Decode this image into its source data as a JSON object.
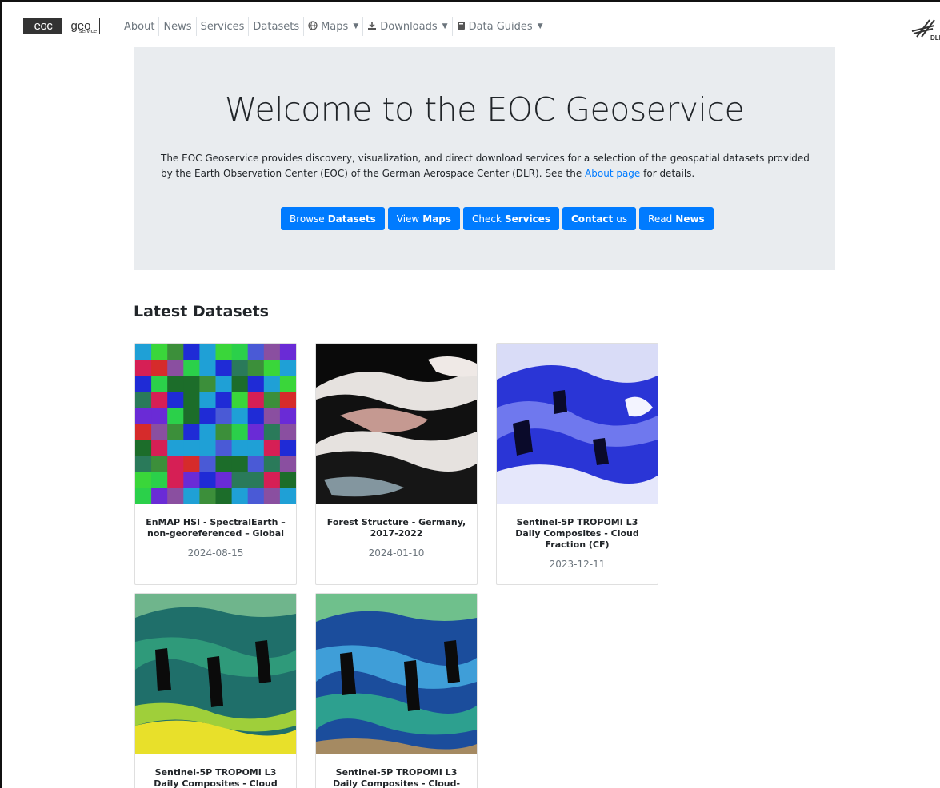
{
  "brand": {
    "part1": "eoc",
    "part2": "geo",
    "part3": "service"
  },
  "nav": {
    "items": [
      {
        "label": "About"
      },
      {
        "label": "News"
      },
      {
        "label": "Services"
      },
      {
        "label": "Datasets"
      },
      {
        "label": "Maps",
        "icon": "globe-icon",
        "dropdown": true
      },
      {
        "label": "Downloads",
        "icon": "download-icon",
        "dropdown": true
      },
      {
        "label": "Data Guides",
        "icon": "book-icon",
        "dropdown": true
      }
    ]
  },
  "dlr_logo": {
    "text": "DLR"
  },
  "hero": {
    "title": "Welcome to the EOC Geoservice",
    "text_before": "The EOC Geoservice provides discovery, visualization, and direct download services for a selection of the geospatial datasets provided by the Earth Observation Center (EOC) of the German Aerospace Center (DLR). See the ",
    "link": "About page",
    "text_after": " for details.",
    "buttons": [
      {
        "pre": "Browse",
        "bold": "Datasets"
      },
      {
        "pre": "View",
        "bold": "Maps"
      },
      {
        "pre": "Check",
        "bold": "Services"
      },
      {
        "bold_first": "Contact",
        "post": "us"
      },
      {
        "pre": "Read",
        "bold": "News"
      }
    ]
  },
  "latest": {
    "title": "Latest Datasets",
    "cards": [
      {
        "title": "EnMAP HSI - SpectralEarth – non-georeferenced – Global",
        "date": "2024-08-15"
      },
      {
        "title": "Forest Structure - Germany, 2017-2022",
        "date": "2024-01-10"
      },
      {
        "title": "Sentinel-5P TROPOMI L3 Daily Composites - Cloud Fraction (CF)",
        "date": "2023-12-11"
      },
      {
        "title": "Sentinel-5P TROPOMI L3 Daily Composites - Cloud",
        "date": ""
      },
      {
        "title": "Sentinel-5P TROPOMI L3 Daily Composites - Cloud-",
        "date": ""
      }
    ]
  },
  "colors": {
    "primary": "#007bff",
    "jumbotron": "#e9ecef",
    "muted": "#6c757d"
  }
}
